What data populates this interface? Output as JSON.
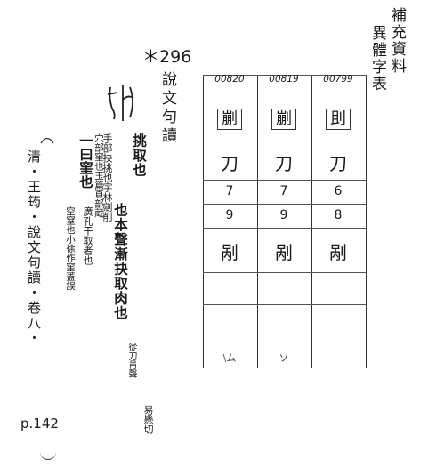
{
  "header": {
    "line1": "補充資料",
    "line2": "異體字表"
  },
  "entry_number": "＊296",
  "book_title": "說文句讀",
  "seal_icon": "seal-script-glyph",
  "table": {
    "codes": [
      "00820",
      "00819",
      "00799"
    ],
    "glyphs": [
      "剻",
      "剻",
      "刞"
    ],
    "radicals": [
      "刀",
      "刀",
      "刀"
    ],
    "stroke_a": [
      "7",
      "7",
      "6"
    ],
    "stroke_b": [
      "9",
      "9",
      "8"
    ],
    "variants": [
      "剐",
      "剐",
      "剐"
    ],
    "footer_marks": [
      "\\ム",
      "ソ",
      ""
    ]
  },
  "commentary": {
    "main1": "挑取也",
    "main1_note": "手部抉挑也字林剜削",
    "main2": "也本聲漸抉取肉也",
    "main2_tail": "從刀肙聲",
    "tail_note": "易懸切",
    "second": "一曰窐也",
    "second_note1": "穴部窐也玉篇頁部蔵",
    "second_note2": "空窒也小徐作窐蓋誤",
    "second_note3": "廣孔干取者也"
  },
  "citation": "清・王筠・說文句讀・卷八・",
  "page_ref": "p.142"
}
